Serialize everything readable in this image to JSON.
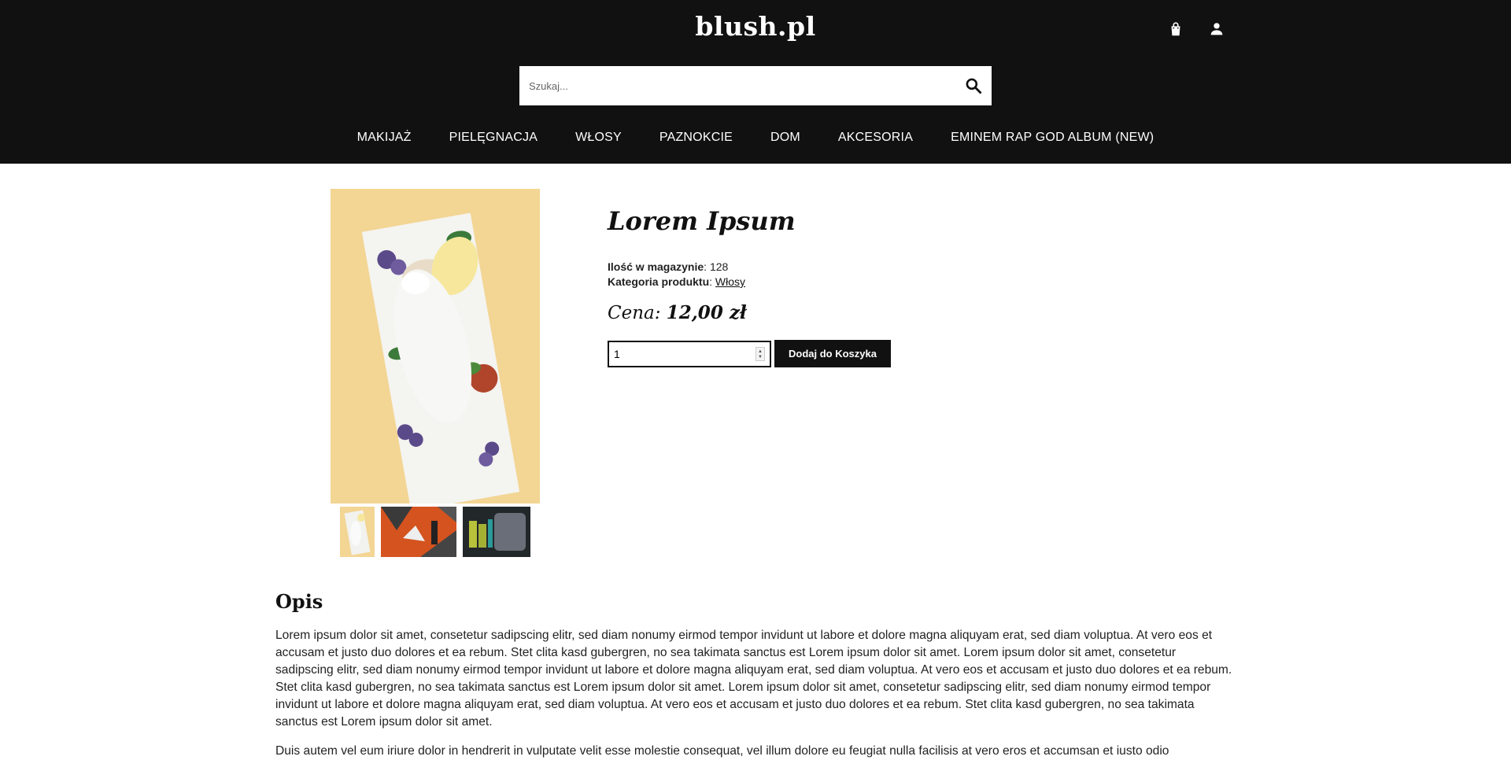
{
  "header": {
    "logo": "blush.pl",
    "icons": {
      "cart": "shopping-bag-icon",
      "account": "person-icon"
    },
    "search": {
      "placeholder": "Szukaj...",
      "value": "",
      "icon": "search-icon"
    },
    "nav": [
      {
        "label": "MAKIJAŻ"
      },
      {
        "label": "PIELĘGNACJA"
      },
      {
        "label": "WŁOSY"
      },
      {
        "label": "PAZNOKCIE"
      },
      {
        "label": "DOM"
      },
      {
        "label": "AKCESORIA"
      },
      {
        "label": "EMINEM RAP GOD ALBUM (NEW)"
      }
    ]
  },
  "product": {
    "title": "Lorem Ipsum",
    "stock_label": "Ilość w magazynie",
    "stock_value": "128",
    "category_label": "Kategoria produktu",
    "category_value": "Włosy",
    "price_label": "Cena:",
    "price_value": "12,00 zł",
    "quantity": "1",
    "add_to_cart_label": "Dodaj do Koszyka",
    "thumbnails": 3
  },
  "description": {
    "heading": "Opis",
    "paragraphs": [
      "Lorem ipsum dolor sit amet, consetetur sadipscing elitr, sed diam nonumy eirmod tempor invidunt ut labore et dolore magna aliquyam erat, sed diam voluptua. At vero eos et accusam et justo duo dolores et ea rebum. Stet clita kasd gubergren, no sea takimata sanctus est Lorem ipsum dolor sit amet. Lorem ipsum dolor sit amet, consetetur sadipscing elitr, sed diam nonumy eirmod tempor invidunt ut labore et dolore magna aliquyam erat, sed diam voluptua. At vero eos et accusam et justo duo dolores et ea rebum. Stet clita kasd gubergren, no sea takimata sanctus est Lorem ipsum dolor sit amet. Lorem ipsum dolor sit amet, consetetur sadipscing elitr, sed diam nonumy eirmod tempor invidunt ut labore et dolore magna aliquyam erat, sed diam voluptua. At vero eos et accusam et justo duo dolores et ea rebum. Stet clita kasd gubergren, no sea takimata sanctus est Lorem ipsum dolor sit amet.",
      "Duis autem vel eum iriure dolor in hendrerit in vulputate velit esse molestie consequat, vel illum dolore eu feugiat nulla facilisis at vero eros et accumsan et iusto odio"
    ]
  },
  "colors": {
    "header_bg": "#111111",
    "button_bg": "#111111",
    "image_bg": "#f3d594"
  }
}
